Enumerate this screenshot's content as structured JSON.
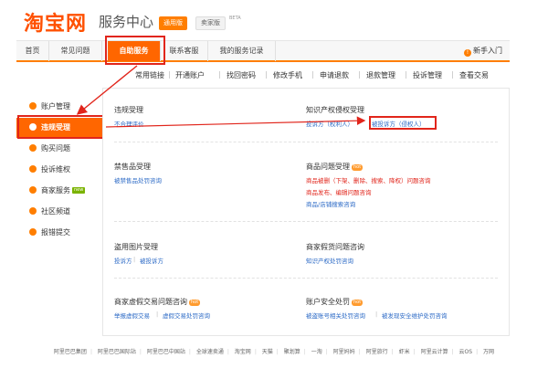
{
  "header": {
    "logo": "淘宝网",
    "title": "服务中心",
    "version_general": "通用版",
    "version_seller": "卖家版",
    "beta": "BETA"
  },
  "nav": {
    "items": [
      "首页",
      "常见问题",
      "自助服务",
      "联系客服",
      "我的服务记录"
    ],
    "active": "自助服务",
    "newbie": "新手入门"
  },
  "subnav": {
    "items": [
      "常用链接",
      "开通账户",
      "找回密码",
      "修改手机",
      "申请退款",
      "退款管理",
      "投诉管理",
      "查看交易"
    ]
  },
  "sidebar": {
    "items": [
      {
        "label": "账户管理"
      },
      {
        "label": "违规受理",
        "active": true
      },
      {
        "label": "购买问题"
      },
      {
        "label": "投诉维权"
      },
      {
        "label": "商家服务",
        "badge": "new"
      },
      {
        "label": "社区频道"
      },
      {
        "label": "报错提交"
      }
    ]
  },
  "content": {
    "s1": {
      "title": "违规受理",
      "link1": "不合理评价"
    },
    "s2": {
      "title": "知识产权侵权受理",
      "link1": "投诉方（权利人）",
      "link2": "被投诉方（侵权人）"
    },
    "s3": {
      "title": "禁售品受理",
      "link1": "被禁售品处罚咨询"
    },
    "s4": {
      "title": "商品问题受理",
      "hot": "hot",
      "link1": "商品被删（下架、删除、搜索、降权）问题咨询",
      "link2": "商品发布、编辑问题咨询",
      "link3": "商品/店铺搜索咨询"
    },
    "s5": {
      "title": "盗用图片受理",
      "link1": "投诉方",
      "link2": "被投诉方"
    },
    "s6": {
      "title": "商家假货问题咨询",
      "link1": "知识产权处罚咨询"
    },
    "s7": {
      "title": "商家虚假交易问题咨询",
      "hot": "hot",
      "link1": "举报虚假交易",
      "link2": "虚假交易处罚咨询"
    },
    "s8": {
      "title": "账户安全处罚",
      "hot": "hot",
      "link1": "被盗账号相关处罚咨询",
      "link2": "被发现安全维护处罚咨询"
    }
  },
  "footer": {
    "links": [
      "阿里巴巴集团",
      "阿里巴巴国际站",
      "阿里巴巴中国站",
      "全球速卖通",
      "淘宝网",
      "天猫",
      "聚划算",
      "一淘",
      "阿里妈妈",
      "阿里旅行",
      "虾米",
      "阿里云计算",
      "云OS",
      "万网"
    ]
  },
  "colors": {
    "accent": "#ff6600",
    "highlight": "#e1251b",
    "link": "#2c6ac6"
  }
}
